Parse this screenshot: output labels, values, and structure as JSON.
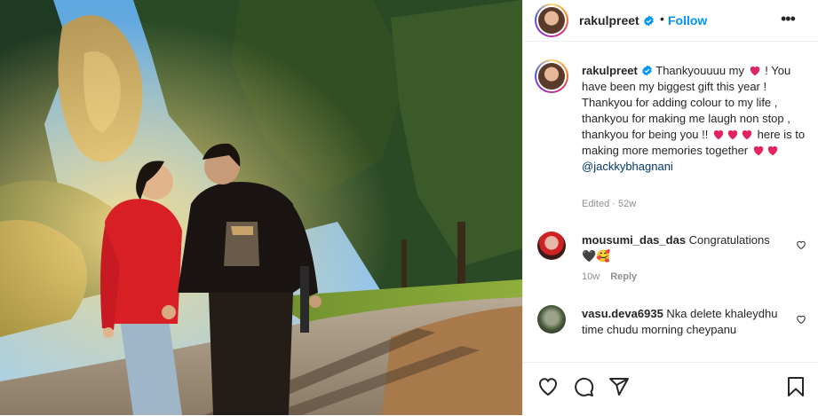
{
  "post": {
    "username": "rakulpreet",
    "follow_label": "Follow",
    "dot": "•",
    "more_glyph": "•••"
  },
  "caption": {
    "username": "rakulpreet",
    "line1": "Thankyouuuu my",
    "line2": "! You have been my biggest gift this year ! Thankyou for adding colour to my life , thankyou for making me laugh non stop , thankyou for being you !!",
    "line3": "here is to making more memories together",
    "mention": "@jackkybhagnani",
    "edited": "Edited · 52w"
  },
  "comments": [
    {
      "username": "mousumi_das_das",
      "text": "Congratulations",
      "emoji": "🖤🥰",
      "age": "10w",
      "reply_label": "Reply"
    },
    {
      "username": "vasu.deva6935",
      "text": "Nka delete khaleydhu time chudu morning cheypanu"
    }
  ],
  "icons": {
    "verified": "verified-badge-icon",
    "heart": "red-heart-emoji",
    "like": "heart-outline-icon",
    "comment": "comment-bubble-icon",
    "share": "paper-plane-icon",
    "save": "bookmark-icon",
    "options": "more-options-icon"
  },
  "colors": {
    "link_blue": "#0095f6",
    "mention_blue": "#00376b",
    "text": "#262626",
    "muted": "#8e8e8e",
    "heart_red": "#e0245e"
  }
}
